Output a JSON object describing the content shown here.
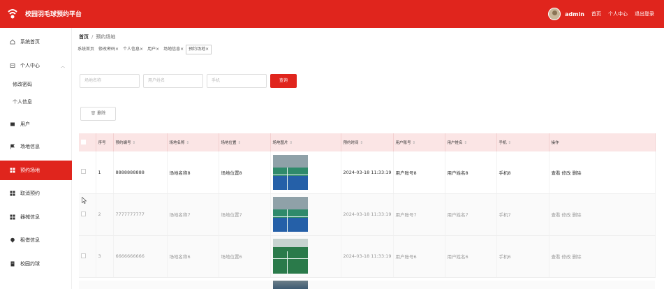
{
  "header": {
    "brand": "校园羽毛球预约平台",
    "username": "admin",
    "links": [
      "首页",
      "个人中心",
      "退出登录"
    ]
  },
  "sidebar": {
    "items": [
      {
        "label": "系统首页",
        "icon": "home-icon"
      },
      {
        "label": "个人中心",
        "icon": "profile-icon"
      },
      {
        "label": "修改密码"
      },
      {
        "label": "个人信息"
      },
      {
        "label": "用户",
        "icon": "user-icon"
      },
      {
        "label": "场地信息",
        "icon": "flag-icon"
      },
      {
        "label": "预约场地",
        "icon": "grid-icon",
        "active": true
      },
      {
        "label": "取消预约",
        "icon": "grid-icon"
      },
      {
        "label": "器械信息",
        "icon": "grid-icon"
      },
      {
        "label": "租借信息",
        "icon": "pin-icon"
      },
      {
        "label": "校园约球",
        "icon": "doc-icon"
      }
    ]
  },
  "breadcrumb": {
    "home": "首页",
    "separator": "/",
    "current": "预约场地"
  },
  "tabs": [
    "系统首页",
    "修改密码×",
    "个人信息×",
    "用户×",
    "场地信息×",
    "预约场地×"
  ],
  "search": {
    "venue_name_placeholder": "场地名称",
    "user_name_placeholder": "用户姓名",
    "phone_placeholder": "手机",
    "search_label": "查询"
  },
  "toolbar": {
    "delete_label": "删除"
  },
  "table": {
    "headers": [
      "序号",
      "预约编号",
      "场地名称",
      "场地位置",
      "场地图片",
      "预约时间",
      "用户账号",
      "用户姓名",
      "手机",
      "操作"
    ],
    "rows": [
      {
        "index": "1",
        "code": "8888888888",
        "name": "场地名称8",
        "location": "场地位置8",
        "time": "2024-03-18 11:33:19",
        "account": "用户账号8",
        "username": "用户姓名8",
        "phone": "手机8"
      },
      {
        "index": "2",
        "code": "7777777777",
        "name": "场地名称7",
        "location": "场地位置7",
        "time": "2024-03-18 11:33:19",
        "account": "用户账号7",
        "username": "用户姓名7",
        "phone": "手机7"
      },
      {
        "index": "3",
        "code": "6666666666",
        "name": "场地名称6",
        "location": "场地位置6",
        "time": "2024-03-18 11:33:19",
        "account": "用户账号6",
        "username": "用户姓名6",
        "phone": "手机6"
      }
    ],
    "actions": {
      "view": "查看",
      "edit": "修改",
      "delete": "删除"
    }
  },
  "colors": {
    "primary": "#e0251d",
    "header_row": "#fbe5e5",
    "link": "#3b78c9"
  }
}
